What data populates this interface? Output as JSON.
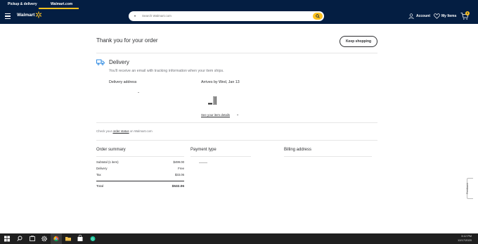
{
  "tabs": {
    "pickup": "Pickup & delivery",
    "walmart": "Walmart.com"
  },
  "header": {
    "logo_text": "Walmart",
    "search_placeholder": "Search Walmart.com",
    "account_label": "Account",
    "my_items_label": "My Items",
    "cart_count": "0"
  },
  "page": {
    "title": "Thank you for your order",
    "keep_shopping": "Keep shopping"
  },
  "delivery": {
    "heading": "Delivery",
    "subtext": "You'll receive an email with tracking information when your item ships.",
    "address_label": "Delivery address",
    "arrives_label": "Arrives by Wed, Jan 13",
    "see_details": "See your item details"
  },
  "status": {
    "prefix": "Check your ",
    "link": "order status",
    "suffix": " on Walmart.com"
  },
  "summary": {
    "title": "Order summary",
    "rows": [
      {
        "label": "Subtotal (1 item)",
        "value": "$499.00"
      },
      {
        "label": "Delivery",
        "value": "Free"
      },
      {
        "label": "Tax",
        "value": "$33.06"
      }
    ],
    "total_label": "Total",
    "total_value": "$532.06"
  },
  "payment": {
    "title": "Payment type"
  },
  "billing": {
    "title": "Billing address"
  },
  "feedback_label": "Feedback",
  "taskbar": {
    "time": "3:12 PM",
    "date": "12/17/2020"
  },
  "colors": {
    "navy": "#041e42",
    "yellow": "#ffc220",
    "blue_truck": "#0071dc"
  }
}
